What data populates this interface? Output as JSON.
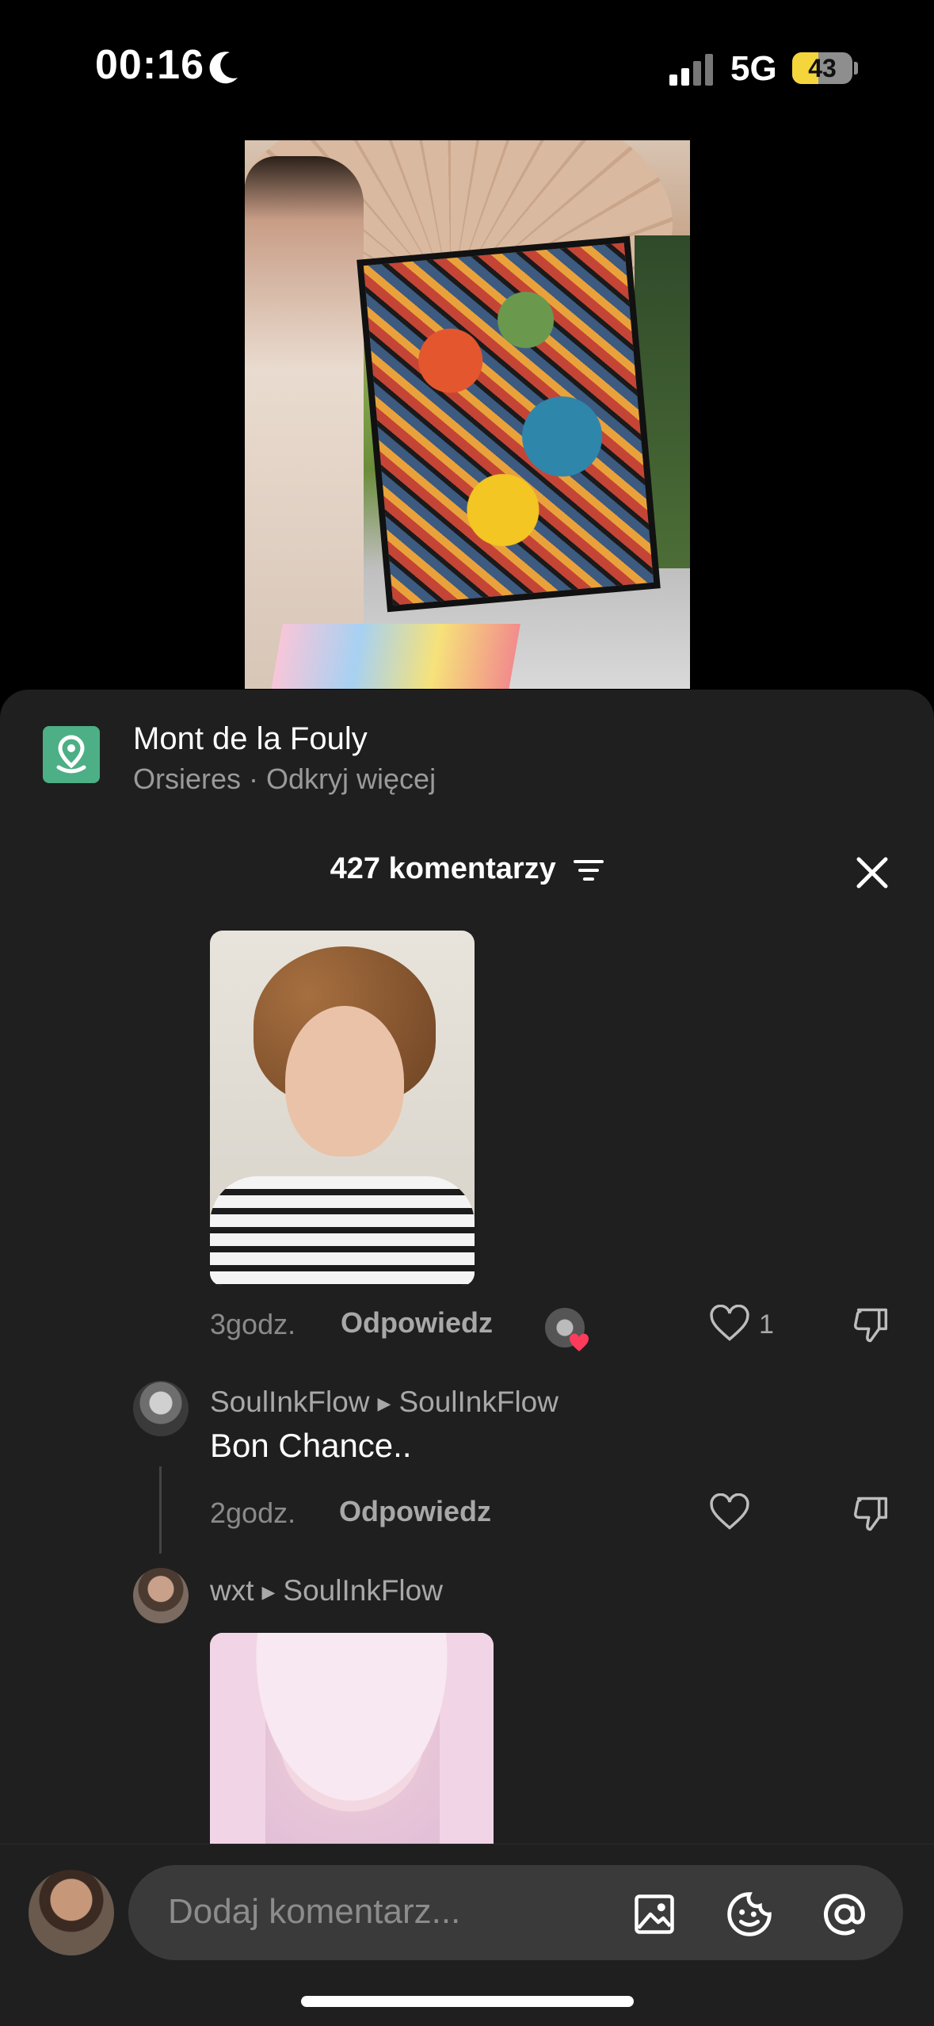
{
  "status_bar": {
    "time": "00:16",
    "network": "5G",
    "battery": "43",
    "battery_level": 0.43
  },
  "location": {
    "title": "Mont de la Fouly",
    "subtitle": "Orsieres · Odkryj więcej"
  },
  "comments_header": {
    "count_label": "427 komentarzy"
  },
  "comments": [
    {
      "time": "3godz.",
      "reply": "Odpowiedz",
      "likes": "1"
    },
    {
      "user": "SoulInkFlow",
      "reply_to": "SoulInkFlow",
      "text": "Bon Chance..",
      "time": "2godz.",
      "reply": "Odpowiedz"
    },
    {
      "user": "wxt",
      "reply_to": "SoulInkFlow"
    }
  ],
  "input": {
    "placeholder": "Dodaj komentarz..."
  },
  "icons": {
    "location": "location-pin-icon",
    "filter": "filter-icon",
    "close": "close-icon",
    "heart": "heart-icon",
    "dislike": "dislike-icon",
    "image": "image-icon",
    "emoji": "emoji-icon",
    "mention": "at-icon"
  },
  "colors": {
    "accent_green": "#4caf85",
    "battery_yellow": "#f5d53c",
    "sheet_bg": "#1f1f1f"
  }
}
